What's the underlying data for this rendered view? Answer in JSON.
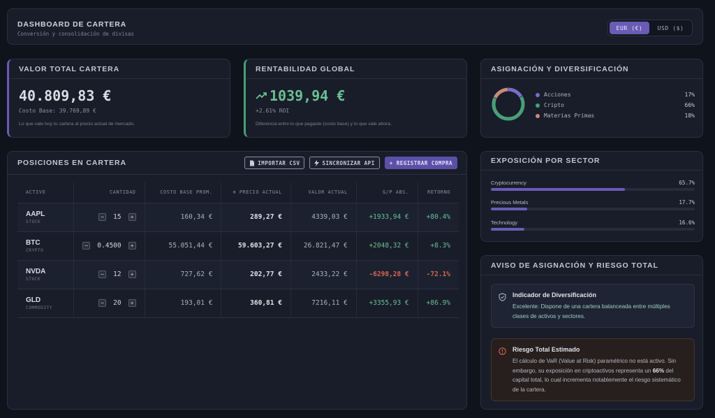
{
  "header": {
    "title": "DASHBOARD DE CARTERA",
    "subtitle": "Conversión y consolidación de divisas",
    "currency_options": [
      "EUR (€)",
      "USD ($)"
    ],
    "selected_currency": "EUR (€)"
  },
  "total_value": {
    "title": "VALOR TOTAL CARTERA",
    "value": "40.809,83 €",
    "cost_base": "Costo Base: 39.769,89 €",
    "description": "Lo que vale hoy tu cartera al precio actual de mercado.",
    "accent": "#6a5bb5"
  },
  "global_return": {
    "title": "RENTABILIDAD GLOBAL",
    "value": "1039,94 €",
    "roi": "+2.61% ROI",
    "description": "Diferencia entre lo que pagaste (costo base) y lo que vale ahora.",
    "icon": "trending-up-icon",
    "accent": "#4a9e78"
  },
  "allocation": {
    "title": "ASIGNACIÓN Y DIVERSIFICACIÓN",
    "items": [
      {
        "label": "Acciones",
        "pct": "17%",
        "value": 17,
        "color": "#7a6cc8"
      },
      {
        "label": "Cripto",
        "pct": "66%",
        "value": 66,
        "color": "#4a9e78"
      },
      {
        "label": "Materias Primas",
        "pct": "18%",
        "value": 18,
        "color": "#c98a78"
      }
    ]
  },
  "positions": {
    "title": "POSICIONES EN CARTERA",
    "buttons": {
      "import": "IMPORTAR CSV",
      "sync": "SINCRONIZAR API",
      "register": "+ REGISTRAR COMPRA"
    },
    "columns": [
      "ACTIVO",
      "CANTIDAD",
      "COSTO BASE PROM.",
      "⊕ PRECIO ACTUAL",
      "VALOR ACTUAL",
      "G/P ABS.",
      "RETORNO"
    ],
    "rows": [
      {
        "symbol": "AAPL",
        "type": "STOCK",
        "qty": "15",
        "cost": "160,34 €",
        "price": "289,27 €",
        "value": "4339,03 €",
        "pl": "+1933,94 €",
        "ret": "+80.4%",
        "negative": false
      },
      {
        "symbol": "BTC",
        "type": "CRYPTO",
        "qty": "0.4500",
        "cost": "55.051,44 €",
        "price": "59.603,27 €",
        "value": "26.821,47 €",
        "pl": "+2048,32 €",
        "ret": "+8.3%",
        "negative": false
      },
      {
        "symbol": "NVDA",
        "type": "STOCK",
        "qty": "12",
        "cost": "727,62 €",
        "price": "202,77 €",
        "value": "2433,22 €",
        "pl": "-6298,28 €",
        "ret": "-72.1%",
        "negative": true
      },
      {
        "symbol": "GLD",
        "type": "COMMODITY",
        "qty": "20",
        "cost": "193,01 €",
        "price": "360,81 €",
        "value": "7216,11 €",
        "pl": "+3355,93 €",
        "ret": "+86.9%",
        "negative": false
      }
    ]
  },
  "sector": {
    "title": "EXPOSICIÓN POR SECTOR",
    "items": [
      {
        "label": "Cryptocurrency",
        "pct": "65.7%",
        "value": 65.7
      },
      {
        "label": "Precious Metals",
        "pct": "17.7%",
        "value": 17.7
      },
      {
        "label": "Technology",
        "pct": "16.6%",
        "value": 16.6
      }
    ]
  },
  "risk": {
    "title": "AVISO DE ASIGNACIÓN Y RIESGO TOTAL",
    "diversification": {
      "title": "Indicador de Diversificación",
      "body": "Excelente: Dispone de una cartera balanceada entre múltiples clases de activos y sectores."
    },
    "total_risk": {
      "title": "Riesgo Total Estimado",
      "body_1": "El cálculo de VaR (Value at Risk) paramétrico no está activo. Sin embargo, su exposición en criptoactivos representa un ",
      "highlight": "66%",
      "body_2": " del capital total, lo cual incrementa notablemente el riesgo sistemático de la cartera."
    }
  }
}
